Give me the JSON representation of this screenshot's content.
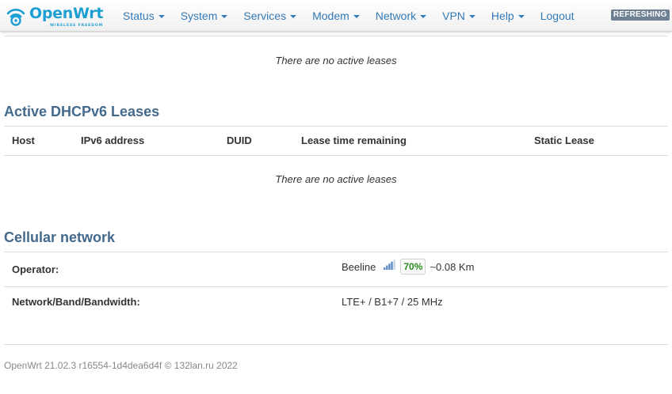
{
  "brand": {
    "name": "OpenWrt",
    "tagline": "WIRELESS FREEDOM"
  },
  "nav": {
    "items": [
      {
        "label": "Status",
        "dropdown": true
      },
      {
        "label": "System",
        "dropdown": true
      },
      {
        "label": "Services",
        "dropdown": true
      },
      {
        "label": "Modem",
        "dropdown": true
      },
      {
        "label": "Network",
        "dropdown": true
      },
      {
        "label": "VPN",
        "dropdown": true
      },
      {
        "label": "Help",
        "dropdown": true
      },
      {
        "label": "Logout",
        "dropdown": false
      }
    ],
    "refresh_badge": "REFRESHING"
  },
  "dhcp_leases": {
    "empty_text": "There are no active leases"
  },
  "dhcpv6_leases": {
    "title": "Active DHCPv6 Leases",
    "columns": [
      "Host",
      "IPv6 address",
      "DUID",
      "Lease time remaining",
      "Static Lease"
    ],
    "empty_text": "There are no active leases"
  },
  "cellular": {
    "title": "Cellular network",
    "operator_label": "Operator:",
    "operator_name": "Beeline",
    "signal_percent": "70%",
    "signal_level": 0.7,
    "distance": "~0.08 Km",
    "band_label": "Network/Band/Bandwidth:",
    "band_value": "LTE+ / B1+7 / 25 MHz"
  },
  "footer": {
    "text": "OpenWrt 21.02.3 r16554-1d4dea6d4f © 132lan.ru 2022"
  },
  "colors": {
    "brand": "#1e9fd4",
    "link": "#337ab7",
    "section_title": "#436a8c",
    "signal_good": "#2a8a1e",
    "badge_bg": "#6e8093"
  }
}
